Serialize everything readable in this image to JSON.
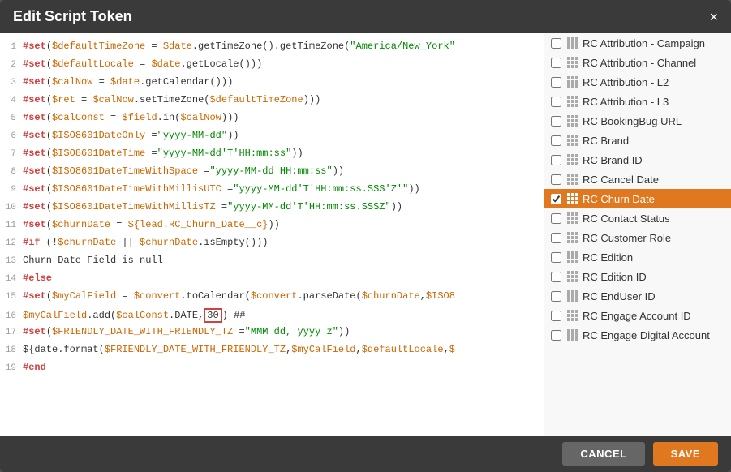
{
  "modal": {
    "title": "Edit Script Token",
    "close_label": "×"
  },
  "code_lines": [
    {
      "num": 1,
      "raw": "#set($defaultTimeZone = $date.getTimeZone().getTimeZone(\"America/New_York\""
    },
    {
      "num": 2,
      "raw": "#set($defaultLocale = $date.getLocale())"
    },
    {
      "num": 3,
      "raw": "#set($calNow = $date.getCalendar())"
    },
    {
      "num": 4,
      "raw": "#set($ret = $calNow.setTimeZone($defaultTimeZone))"
    },
    {
      "num": 5,
      "raw": "#set($calConst = $field.in($calNow))"
    },
    {
      "num": 6,
      "raw": "#set($ISO8601DateOnly =\"yyyy-MM-dd\")"
    },
    {
      "num": 7,
      "raw": "#set($ISO8601DateTime =\"yyyy-MM-dd'T'HH:mm:ss\")"
    },
    {
      "num": 8,
      "raw": "#set($ISO8601DateTimeWithSpace =\"yyyy-MM-dd HH:mm:ss\")"
    },
    {
      "num": 9,
      "raw": "#set($ISO8601DateTimeWithMillisUTC =\"yyyy-MM-dd'T'HH:mm:ss.SSS'Z'\")"
    },
    {
      "num": 10,
      "raw": "#set($ISO8601DateTimeWithMillisTZ =\"yyyy-MM-dd'T'HH:mm:ss.SSSZ\")"
    },
    {
      "num": 11,
      "raw": "#set($churnDate = ${lead.RC_Churn_Date__c})"
    },
    {
      "num": 12,
      "raw": "#if (!$churnDate || $churnDate.isEmpty())"
    },
    {
      "num": 13,
      "raw": "Churn Date Field is null"
    },
    {
      "num": 14,
      "raw": "#else"
    },
    {
      "num": 15,
      "raw": "#set($myCalField = $convert.toCalendar($convert.parseDate($churnDate,$ISO8"
    },
    {
      "num": 16,
      "raw": "$myCalField.add($calConst.DATE,30) ##"
    },
    {
      "num": 17,
      "raw": "#set($FRIENDLY_DATE_WITH_FRIENDLY_TZ =\"MMM dd, yyyy z\")"
    },
    {
      "num": 18,
      "raw": "${date.format($FRIENDLY_DATE_WITH_FRIENDLY_TZ,$myCalField,$defaultLocale,$"
    },
    {
      "num": 19,
      "raw": "#end"
    }
  ],
  "sidebar": {
    "items": [
      {
        "label": "RC Attribution - Campaign",
        "checked": false,
        "selected": false
      },
      {
        "label": "RC Attribution - Channel",
        "checked": false,
        "selected": false
      },
      {
        "label": "RC Attribution - L2",
        "checked": false,
        "selected": false
      },
      {
        "label": "RC Attribution - L3",
        "checked": false,
        "selected": false
      },
      {
        "label": "RC BookingBug URL",
        "checked": false,
        "selected": false
      },
      {
        "label": "RC Brand",
        "checked": false,
        "selected": false
      },
      {
        "label": "RC Brand ID",
        "checked": false,
        "selected": false
      },
      {
        "label": "RC Cancel Date",
        "checked": false,
        "selected": false
      },
      {
        "label": "RC Churn Date",
        "checked": true,
        "selected": true
      },
      {
        "label": "RC Contact Status",
        "checked": false,
        "selected": false
      },
      {
        "label": "RC Customer Role",
        "checked": false,
        "selected": false
      },
      {
        "label": "RC Edition",
        "checked": false,
        "selected": false
      },
      {
        "label": "RC Edition ID",
        "checked": false,
        "selected": false
      },
      {
        "label": "RC EndUser ID",
        "checked": false,
        "selected": false
      },
      {
        "label": "RC Engage Account ID",
        "checked": false,
        "selected": false
      },
      {
        "label": "RC Engage Digital Account",
        "checked": false,
        "selected": false
      }
    ]
  },
  "footer": {
    "cancel_label": "CANCEL",
    "save_label": "SAVE"
  }
}
